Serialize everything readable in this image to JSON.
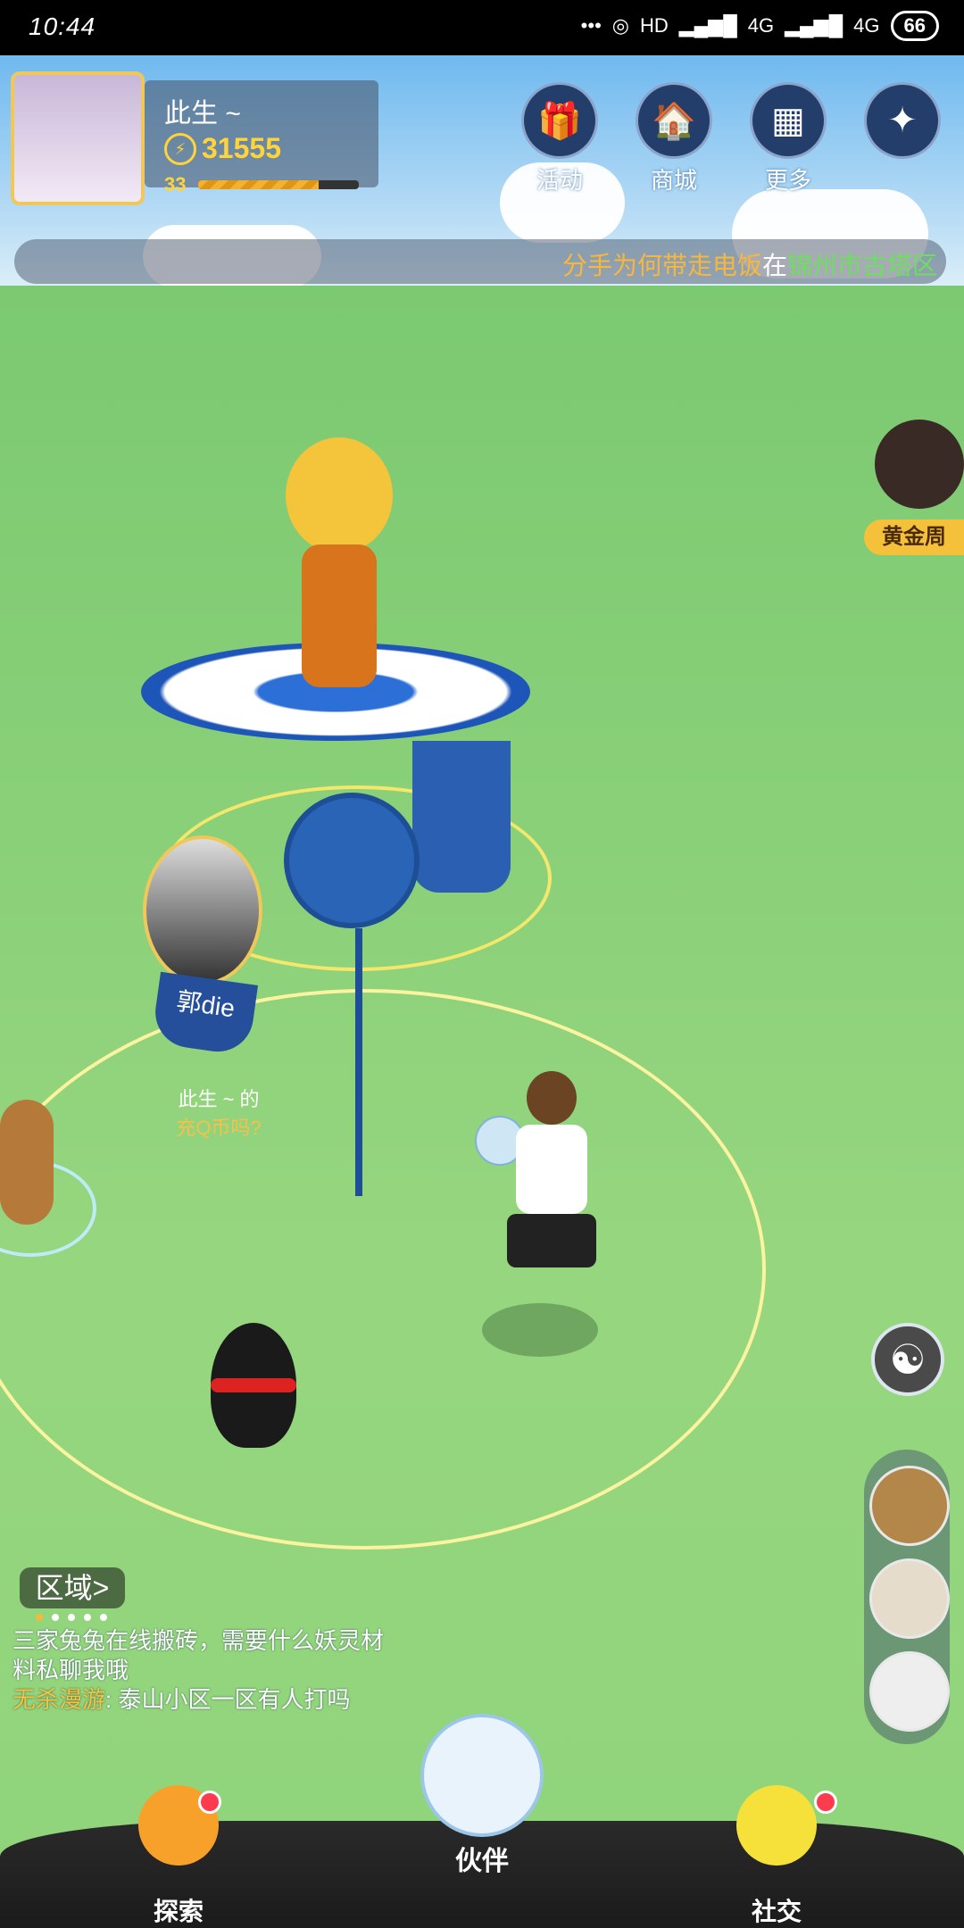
{
  "status_bar": {
    "time": "10:44",
    "signal_labels": [
      "HD",
      "4G",
      "4G"
    ],
    "battery": "66"
  },
  "profile": {
    "name": "此生 ~",
    "coins": "31555",
    "level": "33",
    "level_progress": 0.75
  },
  "top_buttons": [
    {
      "label": "活动",
      "icon": "gift-icon"
    },
    {
      "label": "商城",
      "icon": "shop-icon"
    },
    {
      "label": "更多",
      "icon": "grid-icon"
    },
    {
      "label": "",
      "icon": "compass-icon"
    }
  ],
  "marquee": {
    "part1": "分手为何带走电饭",
    "part2": "在",
    "part3": "锦州市古塔区"
  },
  "event_badge": {
    "label": "黄金周"
  },
  "player_marker": {
    "name": "郭die"
  },
  "speech": {
    "line1": "此生 ~ 的",
    "line2": "充Q币吗?"
  },
  "region": {
    "label": "区域",
    "arrow": ">"
  },
  "chat": [
    {
      "user": "",
      "text": "三家兔兔在线搬砖，需要什么妖灵材料私聊我哦"
    },
    {
      "user": "无杀漫游",
      "text": "泰山小区一区有人打吗"
    }
  ],
  "nav": [
    {
      "label": "探索",
      "badge": true
    },
    {
      "label": "伙伴",
      "badge": false
    },
    {
      "label": "社交",
      "badge": true
    }
  ],
  "colors": {
    "accent_gold": "#f5c13a",
    "nav_bg": "#1b1b1b",
    "badge_red": "#ff3b50"
  }
}
